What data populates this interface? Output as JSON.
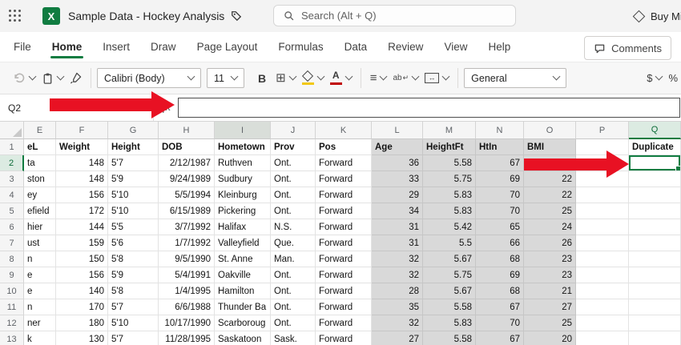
{
  "topbar": {
    "title": "Sample Data - Hockey Analysis",
    "search_placeholder": "Search (Alt + Q)",
    "buy_button_label": "Buy Mi",
    "excel_logo_letter": "X"
  },
  "menubar": {
    "items": [
      "File",
      "Home",
      "Insert",
      "Draw",
      "Page Layout",
      "Formulas",
      "Data",
      "Review",
      "View",
      "Help"
    ],
    "active_item": "Home",
    "comments_button_label": "Comments"
  },
  "ribbon": {
    "font_name": "Calibri (Body)",
    "font_size": "11",
    "bold_label": "B",
    "font_color_letter": "A",
    "wrap_label": "ab",
    "number_format": "General",
    "currency_label": "$",
    "percent_label": "%"
  },
  "formula_bar": {
    "name_box_value": "Q2",
    "fx_label": "fx",
    "formula_value": ""
  },
  "icons": {
    "waffle": "grid-of-dots",
    "excel_logo": "green-square-X",
    "sensitivity_label": "tag",
    "search": "magnifier",
    "premium": "diamond",
    "comments": "speech-bubble",
    "undo": "circular-arrow",
    "paste": "clipboard",
    "format_painter": "brush",
    "borders": "⊞",
    "fill_color": "bucket-with-yellow-bar",
    "font_color": "A-with-red-bar",
    "align": "≡",
    "wrap_arrow": "↵",
    "merge_arrow": "↔",
    "chevron": "v"
  },
  "grid": {
    "selected_cell": "Q2",
    "column_letters": [
      "E",
      "F",
      "G",
      "H",
      "I",
      "J",
      "K",
      "L",
      "M",
      "N",
      "O",
      "P",
      "Q"
    ],
    "header_cells": [
      "eL",
      "Weight",
      "Height",
      "DOB",
      "Hometown",
      "Prov",
      "Pos",
      "Age",
      "HeightFt",
      "HtIn",
      "BMI",
      "",
      "Duplicate"
    ],
    "rows": [
      {
        "num": "2",
        "cells": [
          "ta",
          "148",
          "5'7",
          "2/12/1987",
          "Ruthven",
          "Ont.",
          "Forward",
          "36",
          "5.58",
          "67",
          "",
          "",
          ""
        ]
      },
      {
        "num": "3",
        "cells": [
          "ston",
          "148",
          "5'9",
          "9/24/1989",
          "Sudbury",
          "Ont.",
          "Forward",
          "33",
          "5.75",
          "69",
          "22",
          "",
          ""
        ]
      },
      {
        "num": "4",
        "cells": [
          "ey",
          "156",
          "5'10",
          "5/5/1994",
          "Kleinburg",
          "Ont.",
          "Forward",
          "29",
          "5.83",
          "70",
          "22",
          "",
          ""
        ]
      },
      {
        "num": "5",
        "cells": [
          "efield",
          "172",
          "5'10",
          "6/15/1989",
          "Pickering",
          "Ont.",
          "Forward",
          "34",
          "5.83",
          "70",
          "25",
          "",
          ""
        ]
      },
      {
        "num": "6",
        "cells": [
          "hier",
          "144",
          "5'5",
          "3/7/1992",
          "Halifax",
          "N.S.",
          "Forward",
          "31",
          "5.42",
          "65",
          "24",
          "",
          ""
        ]
      },
      {
        "num": "7",
        "cells": [
          "ust",
          "159",
          "5'6",
          "1/7/1992",
          "Valleyfield",
          "Que.",
          "Forward",
          "31",
          "5.5",
          "66",
          "26",
          "",
          ""
        ]
      },
      {
        "num": "8",
        "cells": [
          "n",
          "150",
          "5'8",
          "9/5/1990",
          "St. Anne",
          "Man.",
          "Forward",
          "32",
          "5.67",
          "68",
          "23",
          "",
          ""
        ]
      },
      {
        "num": "9",
        "cells": [
          "e",
          "156",
          "5'9",
          "5/4/1991",
          "Oakville",
          "Ont.",
          "Forward",
          "32",
          "5.75",
          "69",
          "23",
          "",
          ""
        ]
      },
      {
        "num": "10",
        "cells": [
          "e",
          "140",
          "5'8",
          "1/4/1995",
          "Hamilton",
          "Ont.",
          "Forward",
          "28",
          "5.67",
          "68",
          "21",
          "",
          ""
        ]
      },
      {
        "num": "11",
        "cells": [
          "n",
          "170",
          "5'7",
          "6/6/1988",
          "Thunder Ba",
          "Ont.",
          "Forward",
          "35",
          "5.58",
          "67",
          "27",
          "",
          ""
        ]
      },
      {
        "num": "12",
        "cells": [
          "ner",
          "180",
          "5'10",
          "10/17/1990",
          "Scarboroug",
          "Ont.",
          "Forward",
          "32",
          "5.83",
          "70",
          "25",
          "",
          ""
        ]
      },
      {
        "num": "13",
        "cells": [
          "k",
          "130",
          "5'7",
          "11/28/1995",
          "Saskatoon",
          "Sask.",
          "Forward",
          "27",
          "5.58",
          "67",
          "20",
          "",
          ""
        ]
      }
    ],
    "gray_columns": [
      "L",
      "M",
      "N",
      "O"
    ],
    "right_aligned_columns": [
      "F",
      "H",
      "L",
      "M",
      "N",
      "O"
    ],
    "colors": {
      "selection_green": "#107c41",
      "gray_fill": "#d9d9d9",
      "arrow_red": "#e81123",
      "home_underline": "#107c41"
    }
  },
  "annotations": {
    "arrow1_target": "formula-bar",
    "arrow2_target": "cell-Q2"
  }
}
